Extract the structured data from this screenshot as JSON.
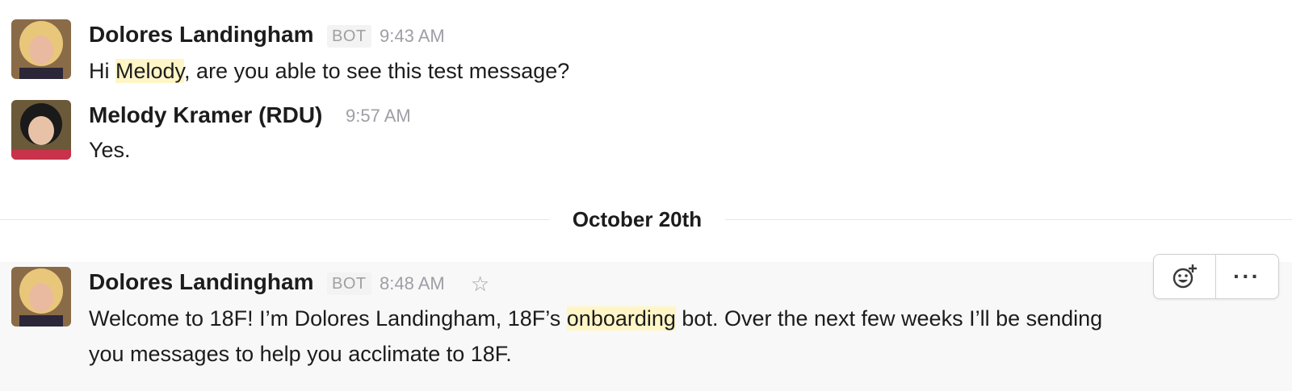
{
  "messages": [
    {
      "sender": "Dolores Landingham",
      "badge": "BOT",
      "time": "9:43 AM",
      "text_before": "Hi ",
      "mention": "Melody",
      "text_after": ", are you able to see this test message?"
    },
    {
      "sender": "Melody Kramer (RDU)",
      "time": "9:57 AM",
      "text": "Yes."
    },
    {
      "sender": "Dolores Landingham",
      "badge": "BOT",
      "time": "8:48 AM",
      "star_icon": "star-icon",
      "line1_before": "Welcome to 18F! I’m Dolores Landingham, 18F’s ",
      "line1_highlight": "onboarding",
      "line1_after": " bot. Over the next few weeks I’ll be sending",
      "line2": "you messages to help you acclimate to 18F."
    }
  ],
  "date_divider": "October 20th",
  "hover_actions": {
    "add_reaction_icon": "add-reaction-icon",
    "more_actions_label": "···"
  },
  "colors": {
    "mention_highlight": "#fff6c7",
    "hover_background": "#f8f8f8",
    "muted_text": "#9e9ea6"
  }
}
